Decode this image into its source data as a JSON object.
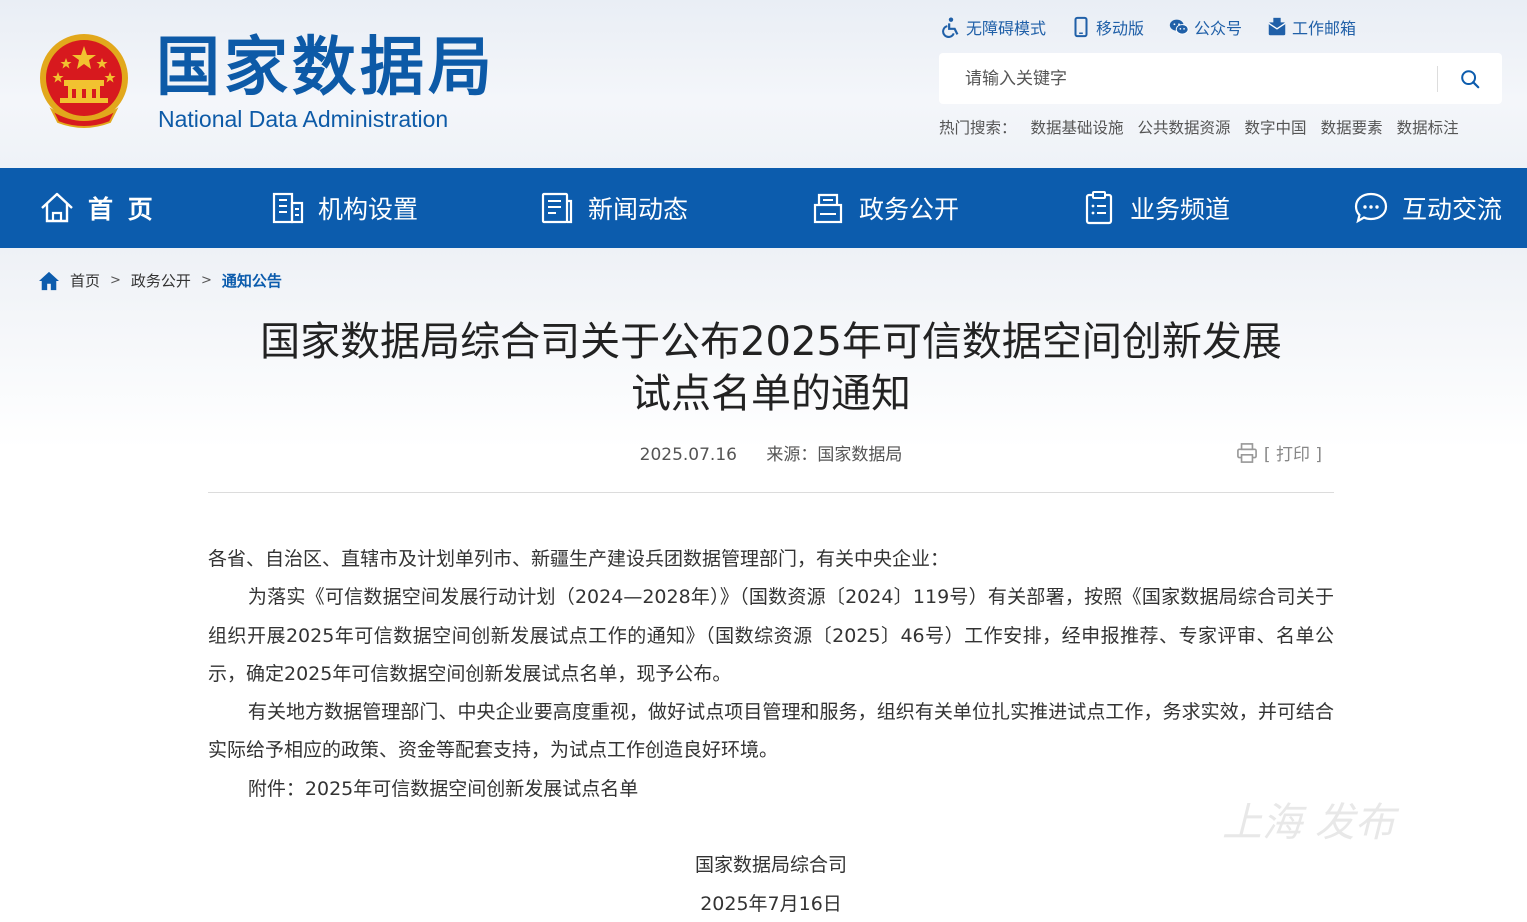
{
  "header": {
    "site_title": "国家数据局",
    "site_title_en": "National Data Administration",
    "top_links": [
      {
        "label": "无障碍模式",
        "icon": "accessibility-icon"
      },
      {
        "label": "移动版",
        "icon": "mobile-icon"
      },
      {
        "label": "公众号",
        "icon": "wechat-icon"
      },
      {
        "label": "工作邮箱",
        "icon": "mailbox-icon"
      }
    ],
    "search_placeholder": "请输入关键字",
    "hot_label": "热门搜索：",
    "hot_items": [
      "数据基础设施",
      "公共数据资源",
      "数字中国",
      "数据要素",
      "数据标注"
    ]
  },
  "nav": {
    "items": [
      {
        "label": "首 页",
        "icon": "home-icon"
      },
      {
        "label": "机构设置",
        "icon": "building-icon"
      },
      {
        "label": "新闻动态",
        "icon": "news-icon"
      },
      {
        "label": "政务公开",
        "icon": "government-icon"
      },
      {
        "label": "业务频道",
        "icon": "clipboard-icon"
      },
      {
        "label": "互动交流",
        "icon": "chat-icon"
      }
    ]
  },
  "breadcrumb": {
    "items": [
      "首页",
      "政务公开",
      "通知公告"
    ],
    "separator": ">"
  },
  "article": {
    "title_line1": "国家数据局综合司关于公布2025年可信数据空间创新发展",
    "title_line2": "试点名单的通知",
    "date": "2025.07.16",
    "source": "来源：国家数据局",
    "print_label": "[ 打印 ]",
    "paragraphs": [
      "各省、自治区、直辖市及计划单列市、新疆生产建设兵团数据管理部门，有关中央企业：",
      "为落实《可信数据空间发展行动计划（2024—2028年）》（国数资源〔2024〕119号）有关部署，按照《国家数据局综合司关于组织开展2025年可信数据空间创新发展试点工作的通知》（国数综资源〔2025〕46号）工作安排，经申报推荐、专家评审、名单公示，确定2025年可信数据空间创新发展试点名单，现予公布。",
      "有关地方数据管理部门、中央企业要高度重视，做好试点项目管理和服务，组织有关单位扎实推进试点工作，务求实效，并可结合实际给予相应的政策、资金等配套支持，为试点工作创造良好环境。",
      "附件：2025年可信数据空间创新发展试点名单"
    ],
    "signature": "国家数据局综合司",
    "sign_date": "2025年7月16日"
  },
  "watermark_text": "上海 发布",
  "colors": {
    "brand_blue": "#0c5cad",
    "nav_text": "#ffffff",
    "title_blue": "#0d5aa7",
    "emblem_red": "#d7191e",
    "emblem_gold": "#f2c230"
  }
}
